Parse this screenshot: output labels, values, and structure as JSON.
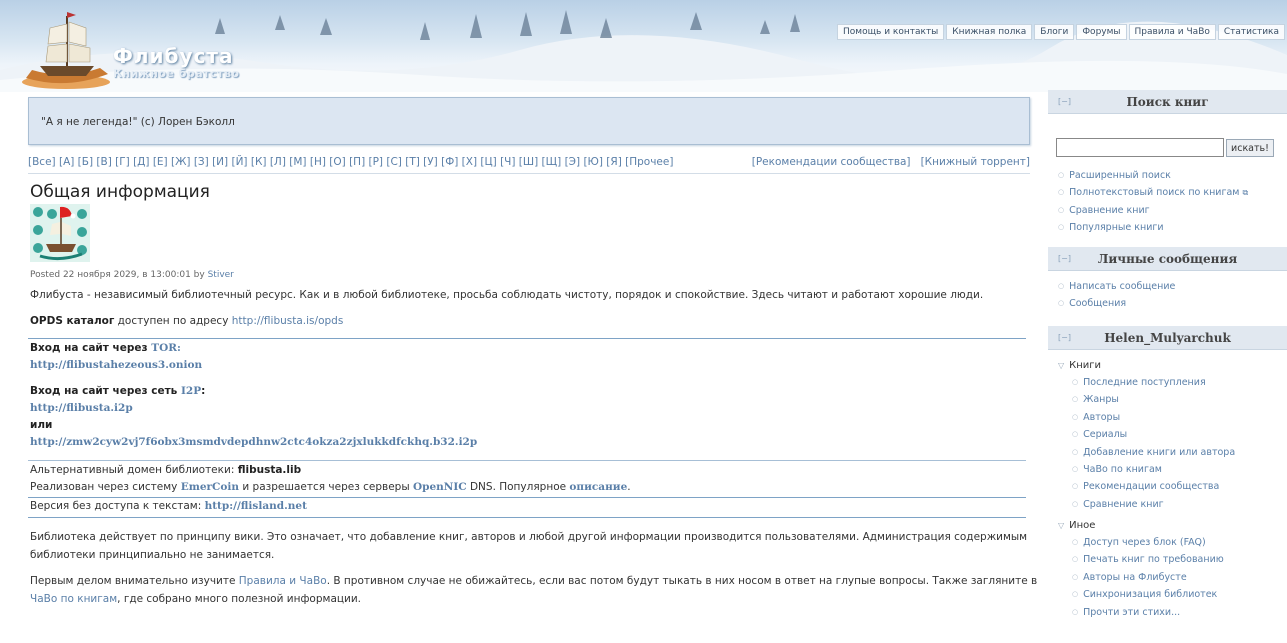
{
  "header": {
    "site_title": "Флибуста",
    "site_subtitle": "Книжное братство",
    "nav": [
      "Помощь и контакты",
      "Книжная полка",
      "Блоги",
      "Форумы",
      "Правила и ЧаВо",
      "Статистика"
    ]
  },
  "quote": "\"А я не легенда!\" (c) Лорен Бэколл",
  "alphabet": {
    "letters": "[Все] [А] [Б] [В] [Г] [Д] [Е] [Ж] [З] [И] [Й] [К] [Л] [М] [Н] [О] [П] [Р] [С] [Т] [У] [Ф] [Х] [Ц] [Ч] [Ш] [Щ] [Э] [Ю] [Я] [Прочее]",
    "recommend": "[Рекомендации сообщества]",
    "torrent": "[Книжный торрент]"
  },
  "article": {
    "title": "Общая информация",
    "posted_prefix": "Posted 22 ноября 2029, в 13:00:01 by ",
    "author": "Stiver",
    "intro": "Флибуста - независимый библиотечный ресурс. Как и в любой библиотеке, просьба соблюдать чистоту, порядок и спокойствие. Здесь читают и работают хорошие люди.",
    "opds_label": "OPDS каталог",
    "opds_text": " доступен по адресу ",
    "opds_url": "http://flibusta.is/opds",
    "tor_label": "Вход на сайт через ",
    "tor_link": "TOR:",
    "tor_url": "http://flibustahezeous3.onion",
    "i2p_label": "Вход на сайт через сеть ",
    "i2p_link": "I2P",
    "i2p_colon": ":",
    "i2p_url": "http://flibusta.i2p",
    "or": "или",
    "i2p_long_url": "http://zmw2cyw2vj7f6obx3msmdvdepdhnw2ctc4okza2zjxlukkdfckhq.b32.i2p",
    "alt_label": "Альтернативный домен библиотеки: ",
    "alt_domain": "flibusta.lib",
    "emercoin_pre": "Реализован через систему ",
    "emercoin": "EmerCoin",
    "emercoin_mid": " и разрешается через серверы ",
    "opennic": "OpenNIC",
    "emercoin_post": " DNS. Популярное ",
    "description_link": "описание",
    "dot": ".",
    "no_text_label": "Версия без доступа к текстам: ",
    "flisland": "http://flisland.net",
    "wiki_line1": "Библиотека действует по принципу вики. Это означает, что добавление книг, авторов и любой другой информации производится пользователями. Администрация содержимым",
    "wiki_line2": "библиотеки принципиально не занимается.",
    "rules_pre": "Первым делом внимательно изучите ",
    "rules_link": "Правила и ЧаВо",
    "rules_post": ". В противном случае не обижайтесь, если вас потом будут тыкать в них носом в ответ на глупые вопросы. Также загляните в",
    "faq_link": "ЧаВо по книгам",
    "faq_post": ", где собрано много полезной информации."
  },
  "sidebar": {
    "toggle": "[−]",
    "search": {
      "title": "Поиск книг",
      "input_value": "",
      "button": "искать!",
      "links": [
        "Расширенный поиск",
        "Полнотекстовый поиск по книгам",
        "Сравнение книг",
        "Популярные книги"
      ]
    },
    "messages": {
      "title": "Личные сообщения",
      "links": [
        "Написать сообщение",
        "Сообщения"
      ]
    },
    "user": {
      "title": "Helen_Mulyarchuk",
      "books_label": "Книги",
      "books": [
        "Последние поступления",
        "Жанры",
        "Авторы",
        "Сериалы",
        "Добавление книги или автора",
        "ЧаВо по книгам",
        "Рекомендации сообщества",
        "Сравнение книг"
      ],
      "other_label": "Иное",
      "other": [
        "Доступ через блок (FAQ)",
        "Печать книг по требованию",
        "Авторы на Флибусте",
        "Синхронизация библиотек",
        "Прочти эти стихи..."
      ]
    }
  },
  "colors": {
    "link": "#5a7fa8",
    "quote_bg": "#dce6f2",
    "sidebar_head": "#e1e8f0"
  }
}
